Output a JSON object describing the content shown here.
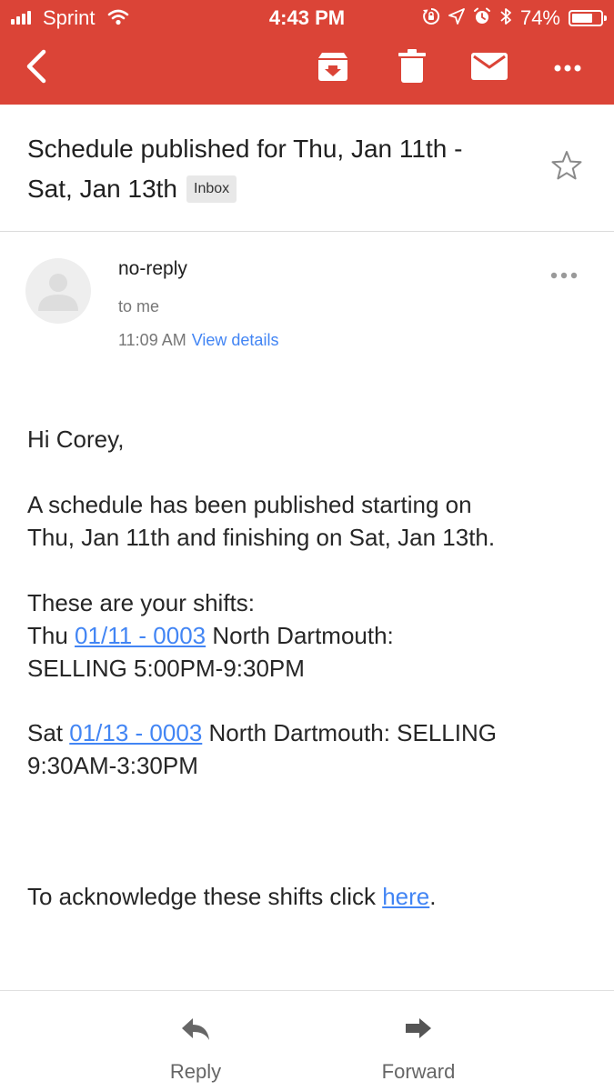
{
  "status_bar": {
    "carrier": "Sprint",
    "time": "4:43 PM",
    "battery_percent": "74%",
    "battery_level": 0.74,
    "icons": [
      "signal-icon",
      "wifi-icon",
      "orientation-lock-icon",
      "location-icon",
      "alarm-icon",
      "bluetooth-icon",
      "battery-icon"
    ]
  },
  "toolbar": {
    "icons": [
      "back-arrow-icon",
      "archive-icon",
      "trash-icon",
      "mail-icon",
      "more-icon"
    ],
    "accent_color": "#db4437"
  },
  "email": {
    "subject_line1": "Schedule published for Thu, Jan 11th -",
    "subject_line2": "Sat, Jan 13th",
    "label": "Inbox",
    "sender": "no-reply",
    "recipient": "to me",
    "time": "11:09 AM",
    "view_details": "View details",
    "body": {
      "greeting": "Hi Corey,",
      "intro_line1": "A schedule has been published starting on",
      "intro_line2": "Thu, Jan 11th and finishing on Sat, Jan 13th.",
      "shifts_heading": "These are your shifts:",
      "shift1": {
        "day": "Thu",
        "link": "01/11 - 0003",
        "location": "North Dartmouth:",
        "line2": "SELLING 5:00PM-9:30PM"
      },
      "shift2": {
        "day": "Sat",
        "link": "01/13 - 0003",
        "location": "North Dartmouth: SELLING",
        "line2": "9:30AM-3:30PM"
      },
      "acknowledge_prefix": "To acknowledge these shifts click",
      "acknowledge_link": "here",
      "acknowledge_suffix": "."
    }
  },
  "actions": {
    "reply": "Reply",
    "forward": "Forward"
  },
  "colors": {
    "link": "#4285f4",
    "header": "#db4437"
  }
}
